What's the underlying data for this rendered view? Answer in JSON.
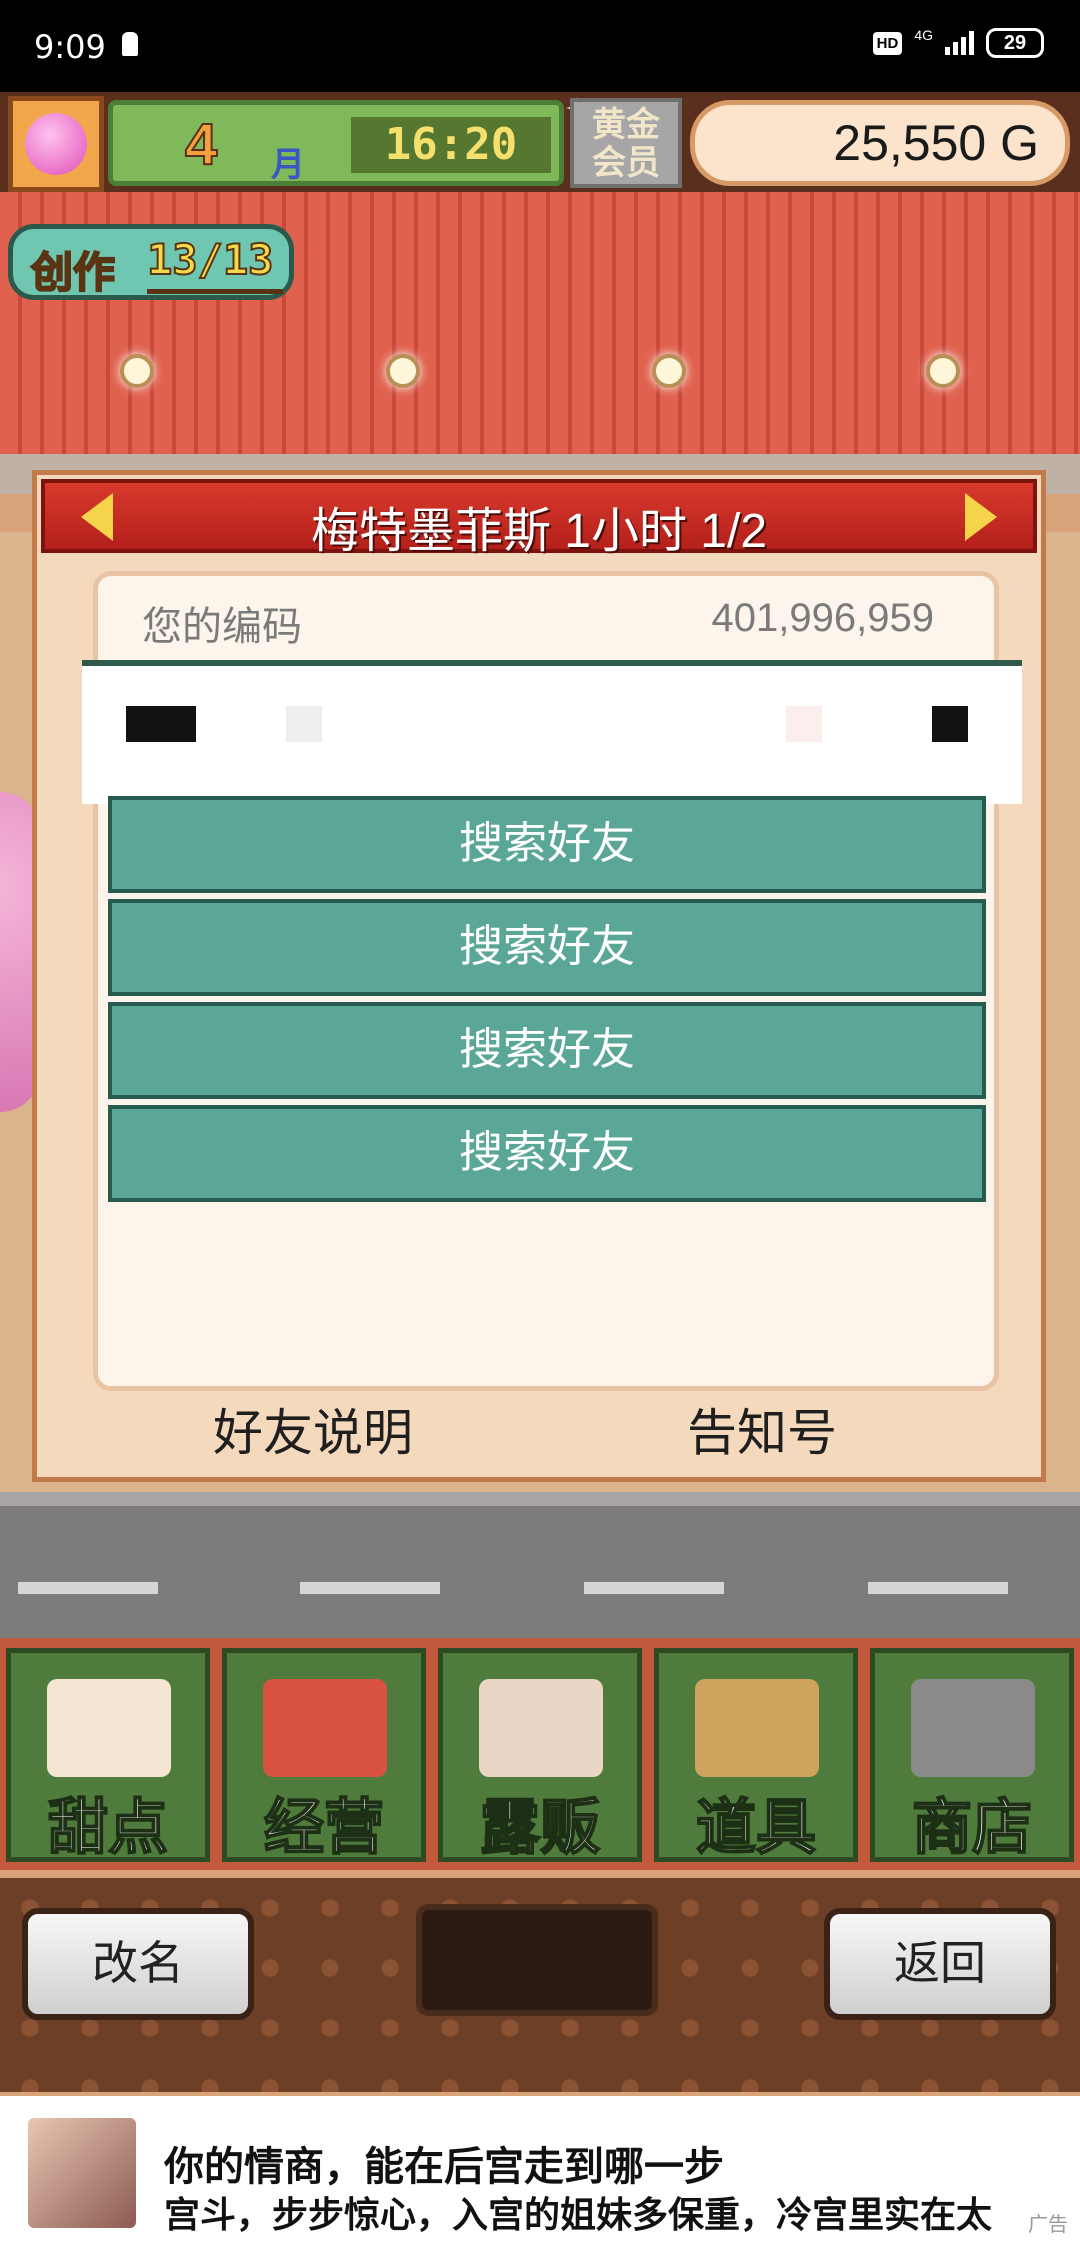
{
  "status_bar": {
    "time": "9:09",
    "hd": "HD",
    "network": "4G",
    "battery": "29"
  },
  "hud": {
    "month": "4",
    "month_unit": "月",
    "clock": "16:20",
    "gold_member": "黄金\n会员",
    "money": "25,550 G"
  },
  "create": {
    "label": "创作",
    "count": "13/13"
  },
  "dialog": {
    "title": "梅特墨菲斯  1小时 1/2",
    "code_label": "您的编码",
    "code_value": "401,996,959",
    "search_buttons": [
      "搜索好友",
      "搜索好友",
      "搜索好友",
      "搜索好友"
    ],
    "link_explain": "好友说明",
    "link_notice": "告知号"
  },
  "menu": {
    "items": [
      {
        "label": "甜点",
        "icon": "cake-icon",
        "color": "#f4e6d2"
      },
      {
        "label": "经营",
        "icon": "shop-icon",
        "color": "#d8533f"
      },
      {
        "label": "露贩",
        "icon": "food-truck-icon",
        "color": "#e9d6c4"
      },
      {
        "label": "道具",
        "icon": "tools-icon",
        "color": "#cfa35d"
      },
      {
        "label": "商店",
        "icon": "cart-icon",
        "color": "#8a8a8a"
      }
    ]
  },
  "bottom": {
    "rename": "改名",
    "back": "返回"
  },
  "ad": {
    "title": "你的情商，能在后宫走到哪一步",
    "subtitle": "宫斗，步步惊心，入宫的姐妹多保重，冷宫里实在太",
    "mark": "广告"
  }
}
